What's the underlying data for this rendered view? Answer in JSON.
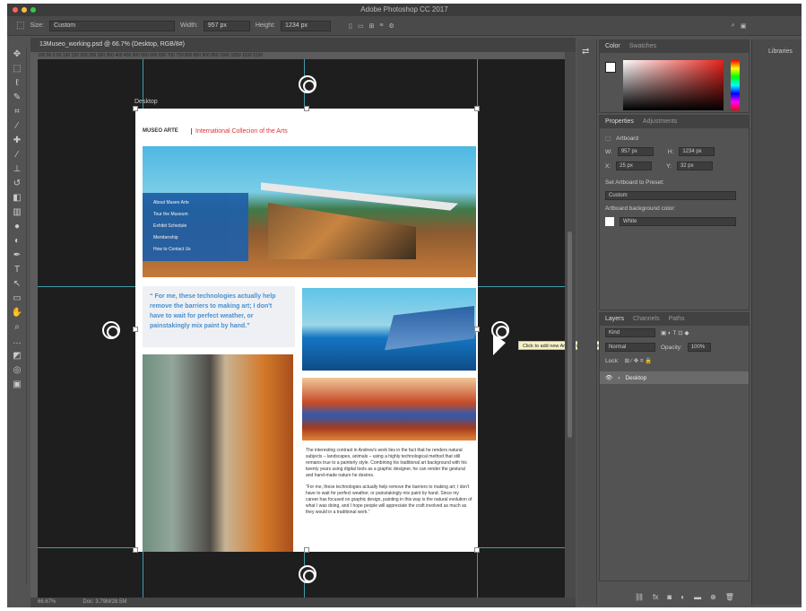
{
  "app": {
    "title": "Adobe Photoshop CC 2017"
  },
  "options_bar": {
    "size_label": "Size:",
    "size_value": "Custom",
    "width_label": "Width:",
    "width_value": "957 px",
    "height_label": "Height:",
    "height_value": "1234 px"
  },
  "document": {
    "tab_title": "13Museo_working.psd @ 66.7% (Desktop, RGB/8#)",
    "zoom": "66.67%",
    "doc_info": "Doc: 3.79M/28.5M",
    "ruler_marks": "100  50  0  50  100  150  200  250  300  350  400  450  500  550  600  650  700  750  800  850  900  950  1000  1050  1100  1150"
  },
  "artboard": {
    "label": "Desktop",
    "logo_text": "MUSEO ARTE",
    "site_title": "International Collecion of the Arts",
    "nav_items": [
      "About Museo Arte",
      "Tour the Museum",
      "Exhibit Schedule",
      "Membership",
      "How to Contact Us"
    ],
    "quote": "“ For me, these technologies actually help remove the barriers to making art; I don't have to wait for perfect weather, or painstakingly mix paint by hand.”",
    "paragraph1": "The interesting contrast in Andrew's work lies in the fact that he renders natural subjects – landscapes, animals – using a highly technological method that still remains true to a painterly style. Combining his traditional art background with his twenty years using digital tools as a graphic designer, he can render the gestural and hand-made nature he desires.",
    "paragraph2": "“For me, these technologies actually help remove the barriers to making art; I don't have to wait for perfect weather, or painstakingly mix paint by hand. Since my career has focused on graphic design, painting in this way is the natural evolution of what I was doing, and I hope people will appreciate the craft involved as much as they would in a traditional work.”"
  },
  "tooltip": "Click to add new Artboard or option-click to also duplicate contents",
  "color_panel": {
    "tab_color": "Color",
    "tab_swatches": "Swatches"
  },
  "properties_panel": {
    "tab_properties": "Properties",
    "tab_adjustments": "Adjustments",
    "section": "Artboard",
    "w_label": "W:",
    "w_value": "957 px",
    "h_label": "H:",
    "h_value": "1234 px",
    "x_label": "X:",
    "x_value": "25 px",
    "y_label": "Y:",
    "y_value": "32 px",
    "preset_label": "Set Artboard to Preset:",
    "preset_value": "Custom",
    "bg_label": "Artboard background color:",
    "bg_value": "White"
  },
  "layers_panel": {
    "tab_layers": "Layers",
    "tab_channels": "Channels",
    "tab_paths": "Paths",
    "filter": "Kind",
    "blend": "Normal",
    "opacity_label": "Opacity:",
    "opacity_value": "100%",
    "lock_label": "Lock:",
    "layer_name": "Desktop"
  },
  "libraries": "Libraries",
  "colors": {
    "ui_bg": "#535353",
    "canvas_bg": "#1e1e1e",
    "guide": "#4fd1e8",
    "nav_blue": "#1f5fa8",
    "title_red": "#dd3333"
  }
}
